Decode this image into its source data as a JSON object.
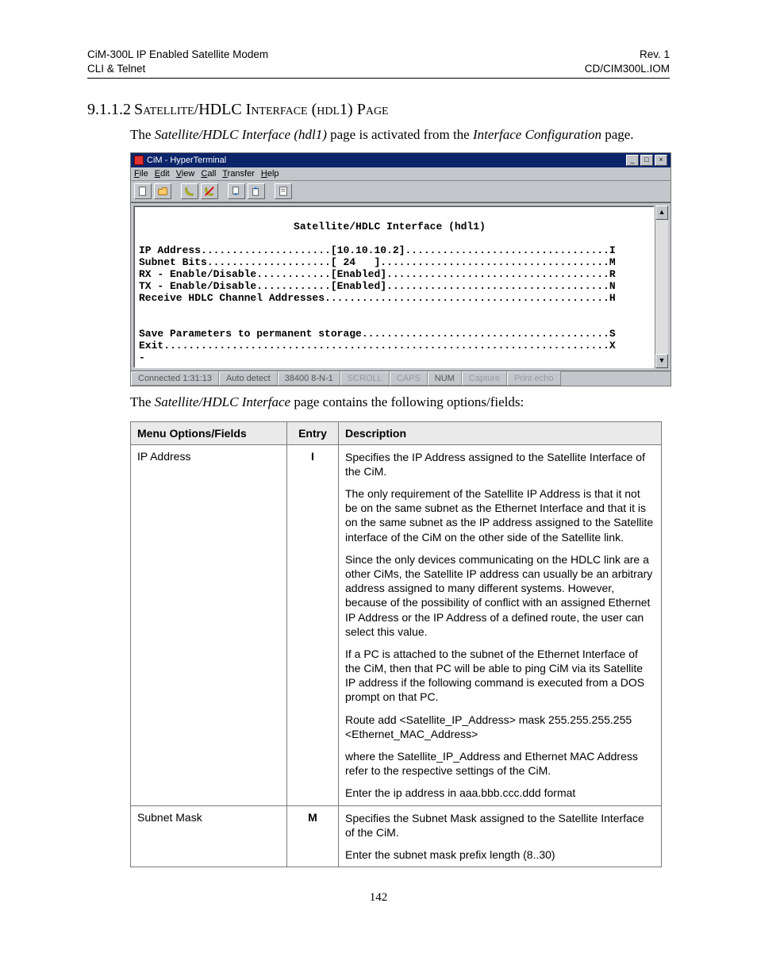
{
  "header": {
    "left_line1": "CiM-300L IP Enabled Satellite Modem",
    "left_line2": "CLI & Telnet",
    "right_line1": "Rev. 1",
    "right_line2": "CD/CIM300L.IOM"
  },
  "section": {
    "number": "9.1.1.2",
    "title": "Satellite/HDLC Interface (hdl1) Page"
  },
  "intro": {
    "pre": "The ",
    "ital1": "Satellite/HDLC Interface (hdl1)",
    "mid": " page is activated from the ",
    "ital2": "Interface Configuration",
    "post": " page."
  },
  "hyperterm": {
    "title": "CiM - HyperTerminal",
    "menu": {
      "file": "File",
      "edit": "Edit",
      "view": "View",
      "call": "Call",
      "transfer": "Transfer",
      "help": "Help"
    },
    "terminal": "\n                         Satellite/HDLC Interface (hdl1)\n\nIP Address.....................[10.10.10.2].................................I\nSubnet Bits....................[ 24   ].....................................M\nRX - Enable/Disable............[Enabled]....................................R\nTX - Enable/Disable............[Enabled]....................................N\nReceive HDLC Channel Addresses..............................................H\n\n\nSave Parameters to permanent storage........................................S\nExit........................................................................X\n-",
    "status": {
      "connected": "Connected 1:31:13",
      "detect": "Auto detect",
      "baud": "38400 8-N-1",
      "scroll": "SCROLL",
      "caps": "CAPS",
      "num": "NUM",
      "capture": "Capture",
      "printecho": "Print echo"
    }
  },
  "lead2": {
    "pre": "The ",
    "ital": "Satellite/HDLC Interface",
    "post": " page contains the following options/fields:"
  },
  "table": {
    "headers": {
      "col1": "Menu Options/Fields",
      "col2": "Entry",
      "col3": "Description"
    },
    "rows": [
      {
        "option": "IP Address",
        "entry": "I",
        "desc": [
          "Specifies the IP Address assigned to the Satellite Interface of the CiM.",
          "The only requirement of the Satellite IP Address is that it not be on the same subnet as the Ethernet Interface and that it is on the same subnet as the IP address assigned to the Satellite interface of the CiM on the other side of the Satellite link.",
          "Since the only devices communicating on the HDLC link are a other CiMs, the Satellite IP address can usually be an arbitrary address assigned to many different systems. However, because of the possibility of conflict with an assigned Ethernet IP Address or the IP Address of a defined route, the user can select this value.",
          "If a PC is attached to the subnet of the Ethernet Interface of the CiM, then that PC will be able to ping CiM via its Satellite IP address if the following command is executed from a DOS prompt on that PC.",
          "Route add <Satellite_IP_Address> mask 255.255.255.255 <Ethernet_MAC_Address>",
          "where the Satellite_IP_Address and Ethernet MAC Address refer to the respective settings of the CiM.",
          "Enter the ip address in aaa.bbb.ccc.ddd format"
        ]
      },
      {
        "option": "Subnet Mask",
        "entry": "M",
        "desc": [
          "Specifies the Subnet Mask assigned to the Satellite Interface of the CiM.",
          "Enter the subnet mask prefix length (8..30)"
        ]
      }
    ]
  },
  "page_number": "142"
}
